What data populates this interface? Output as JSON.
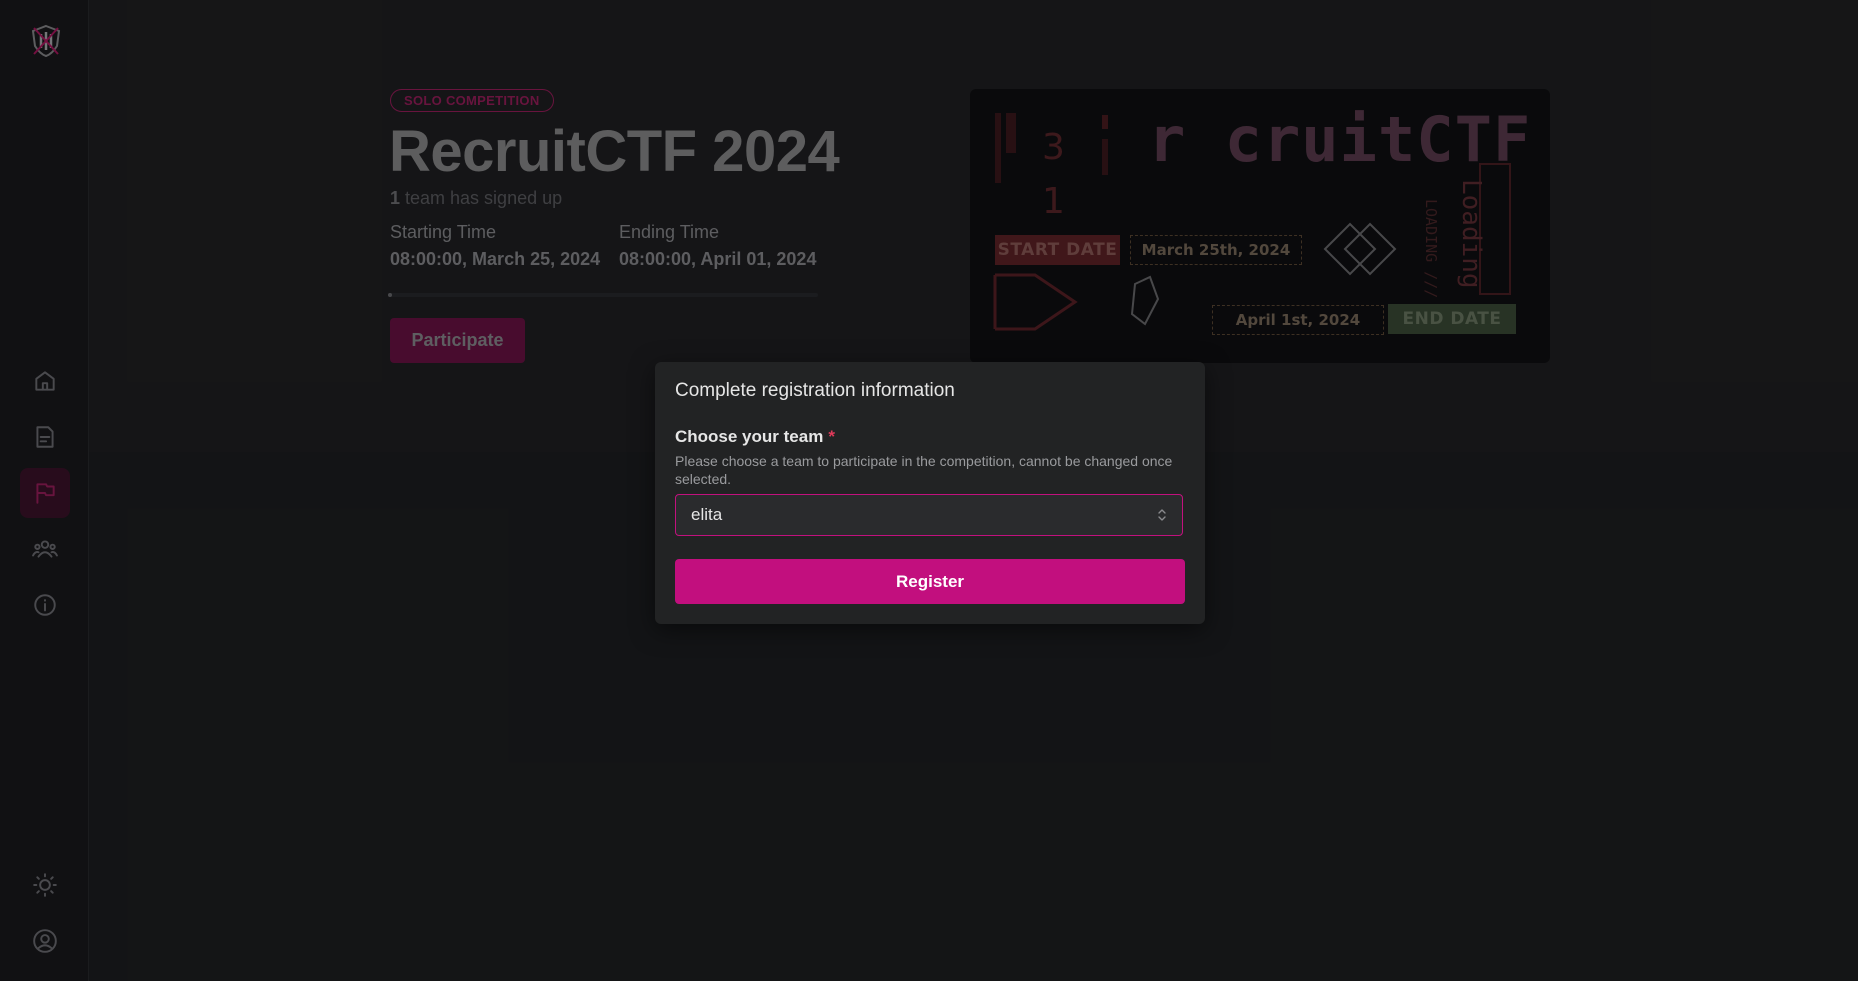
{
  "sidebar": {
    "items": [
      {
        "name": "home-icon",
        "active": false
      },
      {
        "name": "document-icon",
        "active": false
      },
      {
        "name": "flag-icon",
        "active": true
      },
      {
        "name": "team-icon",
        "active": false
      },
      {
        "name": "info-icon",
        "active": false
      }
    ],
    "bottom": [
      {
        "name": "theme-sun-icon"
      },
      {
        "name": "user-avatar-icon"
      }
    ]
  },
  "competition": {
    "badge": "SOLO COMPETITION",
    "title": "RecruitCTF 2024",
    "signed_count": "1",
    "signed_text": " team has signed up",
    "start_label": "Starting Time",
    "start_value": "08:00:00, March 25, 2024",
    "end_label": "Ending Time",
    "end_value": "08:00:00, April 01, 2024",
    "progress_percent": 1,
    "participate_label": "Participate"
  },
  "banner": {
    "brand": "r cruitCTF",
    "start_tag": "START DATE",
    "start_date": "March 25th, 2024",
    "end_date": "April 1st, 2024",
    "end_tag": "END DATE",
    "loading": "Loading",
    "loading_small": "LOADING ///",
    "num_top": "3",
    "num_bottom": "1"
  },
  "modal": {
    "title": "Complete registration information",
    "field_label": "Choose your team",
    "required_mark": "*",
    "field_description": "Please choose a team to participate in the competition, cannot be changed once selected.",
    "selected_team": "elita",
    "register_label": "Register"
  },
  "colors": {
    "accent": "#c20f7e",
    "background": "#1a1b1c",
    "modal": "#222324"
  }
}
